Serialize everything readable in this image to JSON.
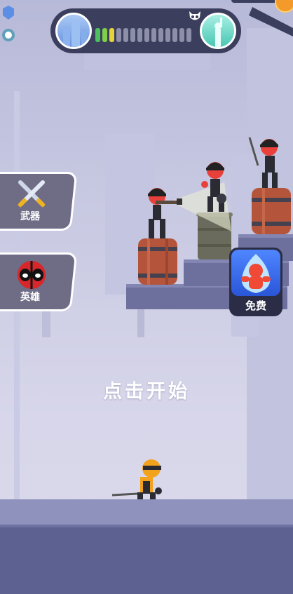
{
  "hud": {
    "progress_segments": [
      "#4cc15e",
      "#7fcf4a",
      "#e6d33a",
      "#8d8fa8",
      "#8d8fa8",
      "#8d8fa8",
      "#8d8fa8",
      "#8d8fa8",
      "#8d8fa8",
      "#8d8fa8",
      "#8d8fa8",
      "#8d8fa8",
      "#8d8fa8",
      "#8d8fa8"
    ],
    "progress_filled": 3,
    "boss_icon": "skull-icon",
    "start_level_icon": "city-icon",
    "end_level_icon": "statue-of-liberty-icon"
  },
  "menu": {
    "weapons_label": "武器",
    "heroes_label": "英雄",
    "free_label": "免费"
  },
  "prompt": {
    "start_text": "点击开始"
  },
  "colors": {
    "enemy_red": "#e8413b",
    "player_orange": "#f3a21c",
    "button_blue": "#3b6cf0"
  }
}
